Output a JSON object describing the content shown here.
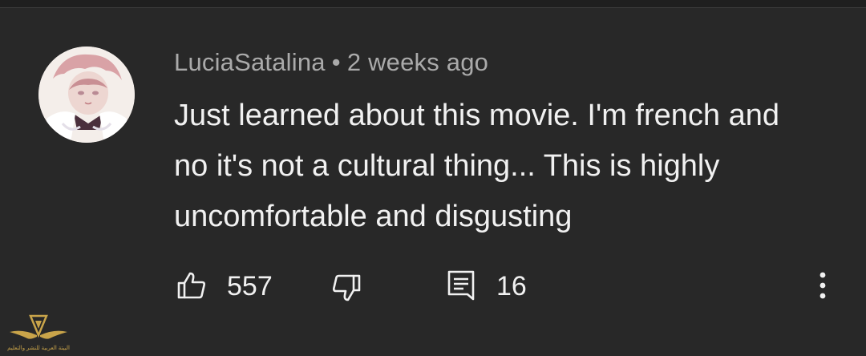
{
  "comment": {
    "author": "LuciaSatalina",
    "separator": "•",
    "timestamp": "2 weeks ago",
    "text": "Just learned about this movie. I'm french and no it's not a cultural thing... This is highly uncomfortable and disgusting"
  },
  "actions": {
    "likes": "557",
    "replies": "16"
  },
  "icons": {
    "like": "thumbs-up-icon",
    "dislike": "thumbs-down-icon",
    "reply": "comment-icon",
    "menu": "more-vertical-icon"
  },
  "watermark": {
    "text": "البيتة العربية للنشر والتعليم"
  },
  "colors": {
    "background": "#282828",
    "text": "#f1f1f1",
    "meta": "#aaaaaa",
    "watermark": "#c9a44a"
  }
}
